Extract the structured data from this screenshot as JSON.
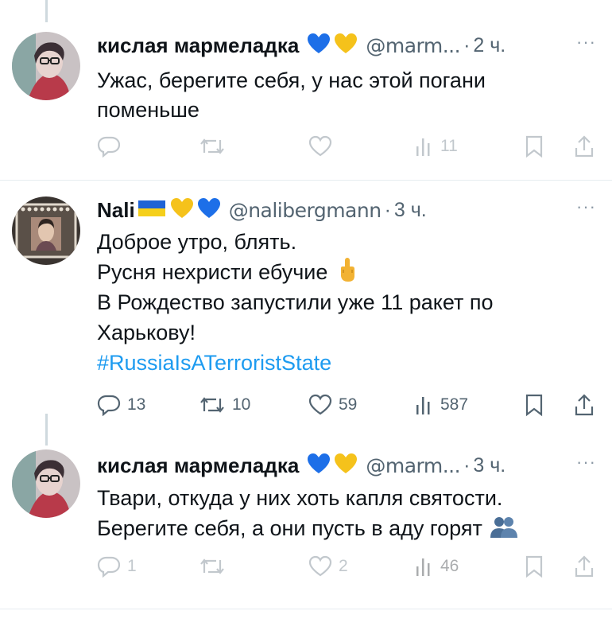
{
  "tweets": [
    {
      "name": "кислая мармеладка",
      "handle": "@marm...",
      "time": "2 ч.",
      "lines": [
        "Ужас, берегите себя, у нас этой погани",
        "поменьше"
      ],
      "counts": {
        "reply": "",
        "retweet": "",
        "like": "",
        "views": "11"
      },
      "badges": [
        "blue-heart",
        "yellow-heart"
      ]
    },
    {
      "name": "Nali",
      "handle": "@nalibergmann",
      "time": "3 ч.",
      "lines": [
        "Доброе утро, блять.",
        "Русня нехристи ебучие",
        "В Рождество запустили уже 11 ракет по",
        "Харькову!"
      ],
      "hashtag": "#RussiaIsATerroristState",
      "counts": {
        "reply": "13",
        "retweet": "10",
        "like": "59",
        "views": "587"
      },
      "badges": [
        "ukraine-flag",
        "yellow-heart",
        "blue-heart"
      ],
      "inline_emoji": "middle-finger"
    },
    {
      "name": "кислая мармеладка",
      "handle": "@marm...",
      "time": "3 ч.",
      "lines": [
        "Твари, откуда у них хоть капля святости.",
        "Берегите себя, а они пусть в аду горят"
      ],
      "counts": {
        "reply": "1",
        "retweet": "",
        "like": "2",
        "views": "46"
      },
      "badges": [
        "blue-heart",
        "yellow-heart"
      ],
      "inline_emoji": "people-silhouette"
    }
  ],
  "separator": "·",
  "more_label": "···",
  "colors": {
    "text": "#0f1419",
    "secondary": "#536471",
    "link": "#1d9bf0",
    "divider": "#e6ecf0"
  }
}
